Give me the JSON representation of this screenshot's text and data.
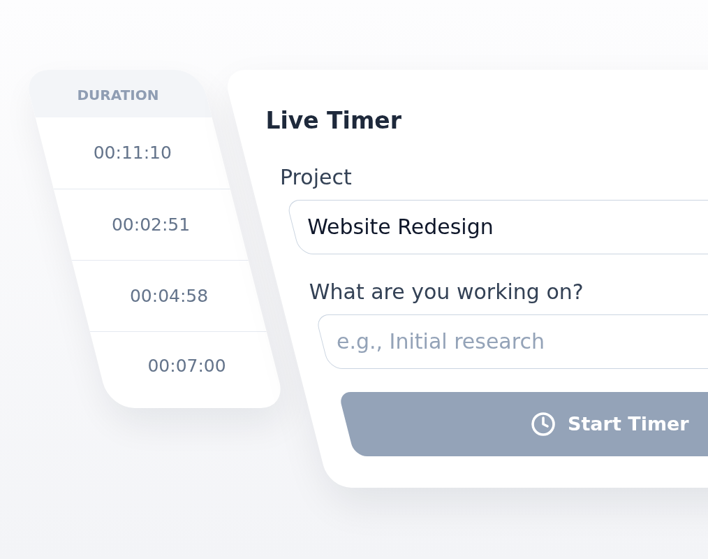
{
  "duration_table": {
    "header": "DURATION",
    "rows": [
      "00:11:10",
      "00:02:51",
      "00:04:58",
      "00:07:00"
    ]
  },
  "timer_card": {
    "title": "Live Timer",
    "project": {
      "label": "Project",
      "value": "Website Redesign"
    },
    "task": {
      "label": "What are you working on?",
      "placeholder": "e.g., Initial research"
    },
    "start_button": {
      "label": "Start Timer",
      "disabled": true
    }
  }
}
